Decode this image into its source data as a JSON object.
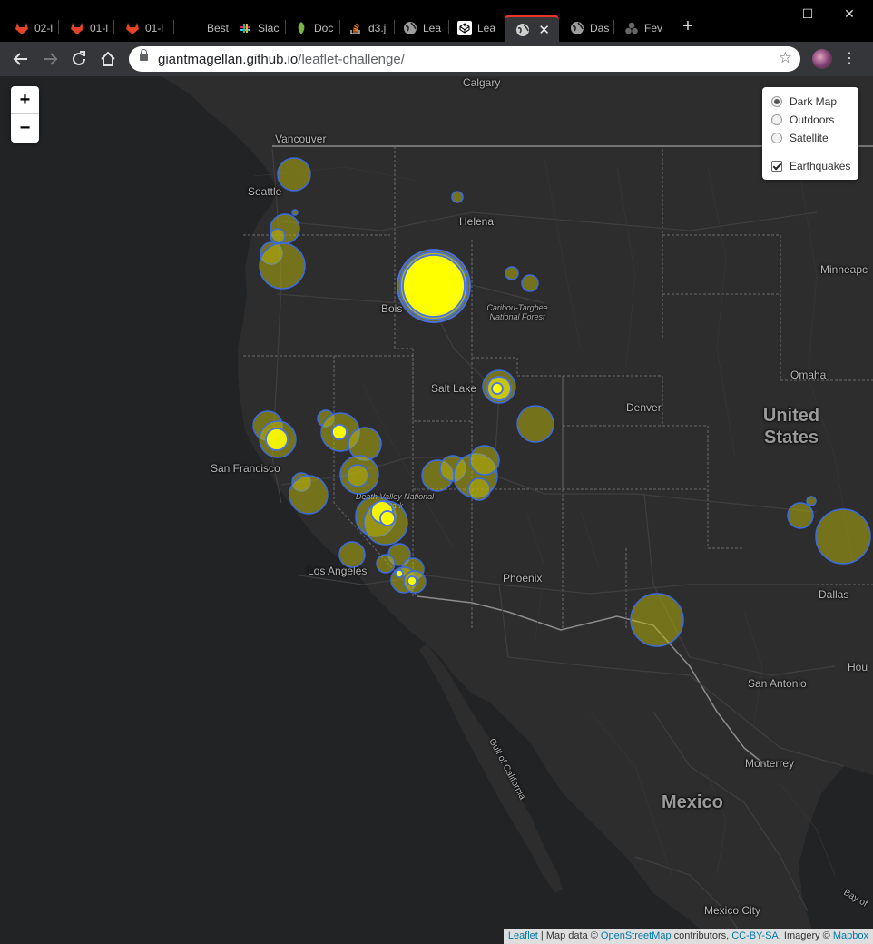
{
  "browser": {
    "tabs": [
      {
        "label": "02-l",
        "icon": "gitlab-icon",
        "active": false
      },
      {
        "label": "01-l",
        "icon": "gitlab-icon",
        "active": false
      },
      {
        "label": "01-l",
        "icon": "gitlab-icon",
        "active": false
      },
      {
        "label": "Best",
        "icon": "blank-icon",
        "active": false
      },
      {
        "label": "Slac",
        "icon": "slack-icon",
        "active": false
      },
      {
        "label": "Doc",
        "icon": "leaf-icon",
        "active": false
      },
      {
        "label": "d3.j",
        "icon": "stackoverflow-icon",
        "active": false
      },
      {
        "label": "Lea",
        "icon": "globe-icon",
        "active": false
      },
      {
        "label": "Lea",
        "icon": "codepen-icon",
        "active": false
      },
      {
        "label": "",
        "icon": "globe-icon",
        "active": true
      },
      {
        "label": "Das",
        "icon": "globe-icon",
        "active": false
      },
      {
        "label": "Fev",
        "icon": "cluster-icon",
        "active": false
      }
    ],
    "new_tab": "+",
    "window_controls": {
      "minimize": "—",
      "maximize": "☐",
      "close": "✕"
    },
    "url_host": "giantmagellan.github.io",
    "url_path": "/leaflet-challenge/"
  },
  "map": {
    "zoom_in": "+",
    "zoom_out": "−",
    "layers": {
      "base": [
        {
          "label": "Dark Map",
          "selected": true
        },
        {
          "label": "Outdoors",
          "selected": false
        },
        {
          "label": "Satellite",
          "selected": false
        }
      ],
      "overlays": [
        {
          "label": "Earthquakes",
          "checked": true
        }
      ]
    },
    "labels": {
      "calgary": "Calgary",
      "vancouver": "Vancouver",
      "seattle": "Seattle",
      "helena": "Helena",
      "minneapolis": "Minneapc",
      "boise": "Bois",
      "caribou_1": "Caribou-Targhee",
      "caribou_2": "National Forest",
      "omaha": "Omaha",
      "salt_lake": "Salt Lake",
      "denver": "Denver",
      "us_1": "United",
      "us_2": "States",
      "san_francisco": "San Francisco",
      "death_valley": "Death Valley National",
      "death_valley_2": "Park",
      "los_angeles": "Los Angeles",
      "phoenix": "Phoenix",
      "dallas": "Dallas",
      "houston": "Hou",
      "san_antonio": "San Antonio",
      "gulf": "Gulf of California",
      "monterrey": "Monterrey",
      "mexico": "Mexico",
      "mexico_city": "Mexico City",
      "bay": "Bay of"
    },
    "attribution": {
      "leaflet": "Leaflet",
      "text1": " | Map data © ",
      "osm": "OpenStreetMap",
      "text2": " contributors, ",
      "license": "CC-BY-SA",
      "text3": ", Imagery © ",
      "mapbox": "Mapbox"
    }
  }
}
